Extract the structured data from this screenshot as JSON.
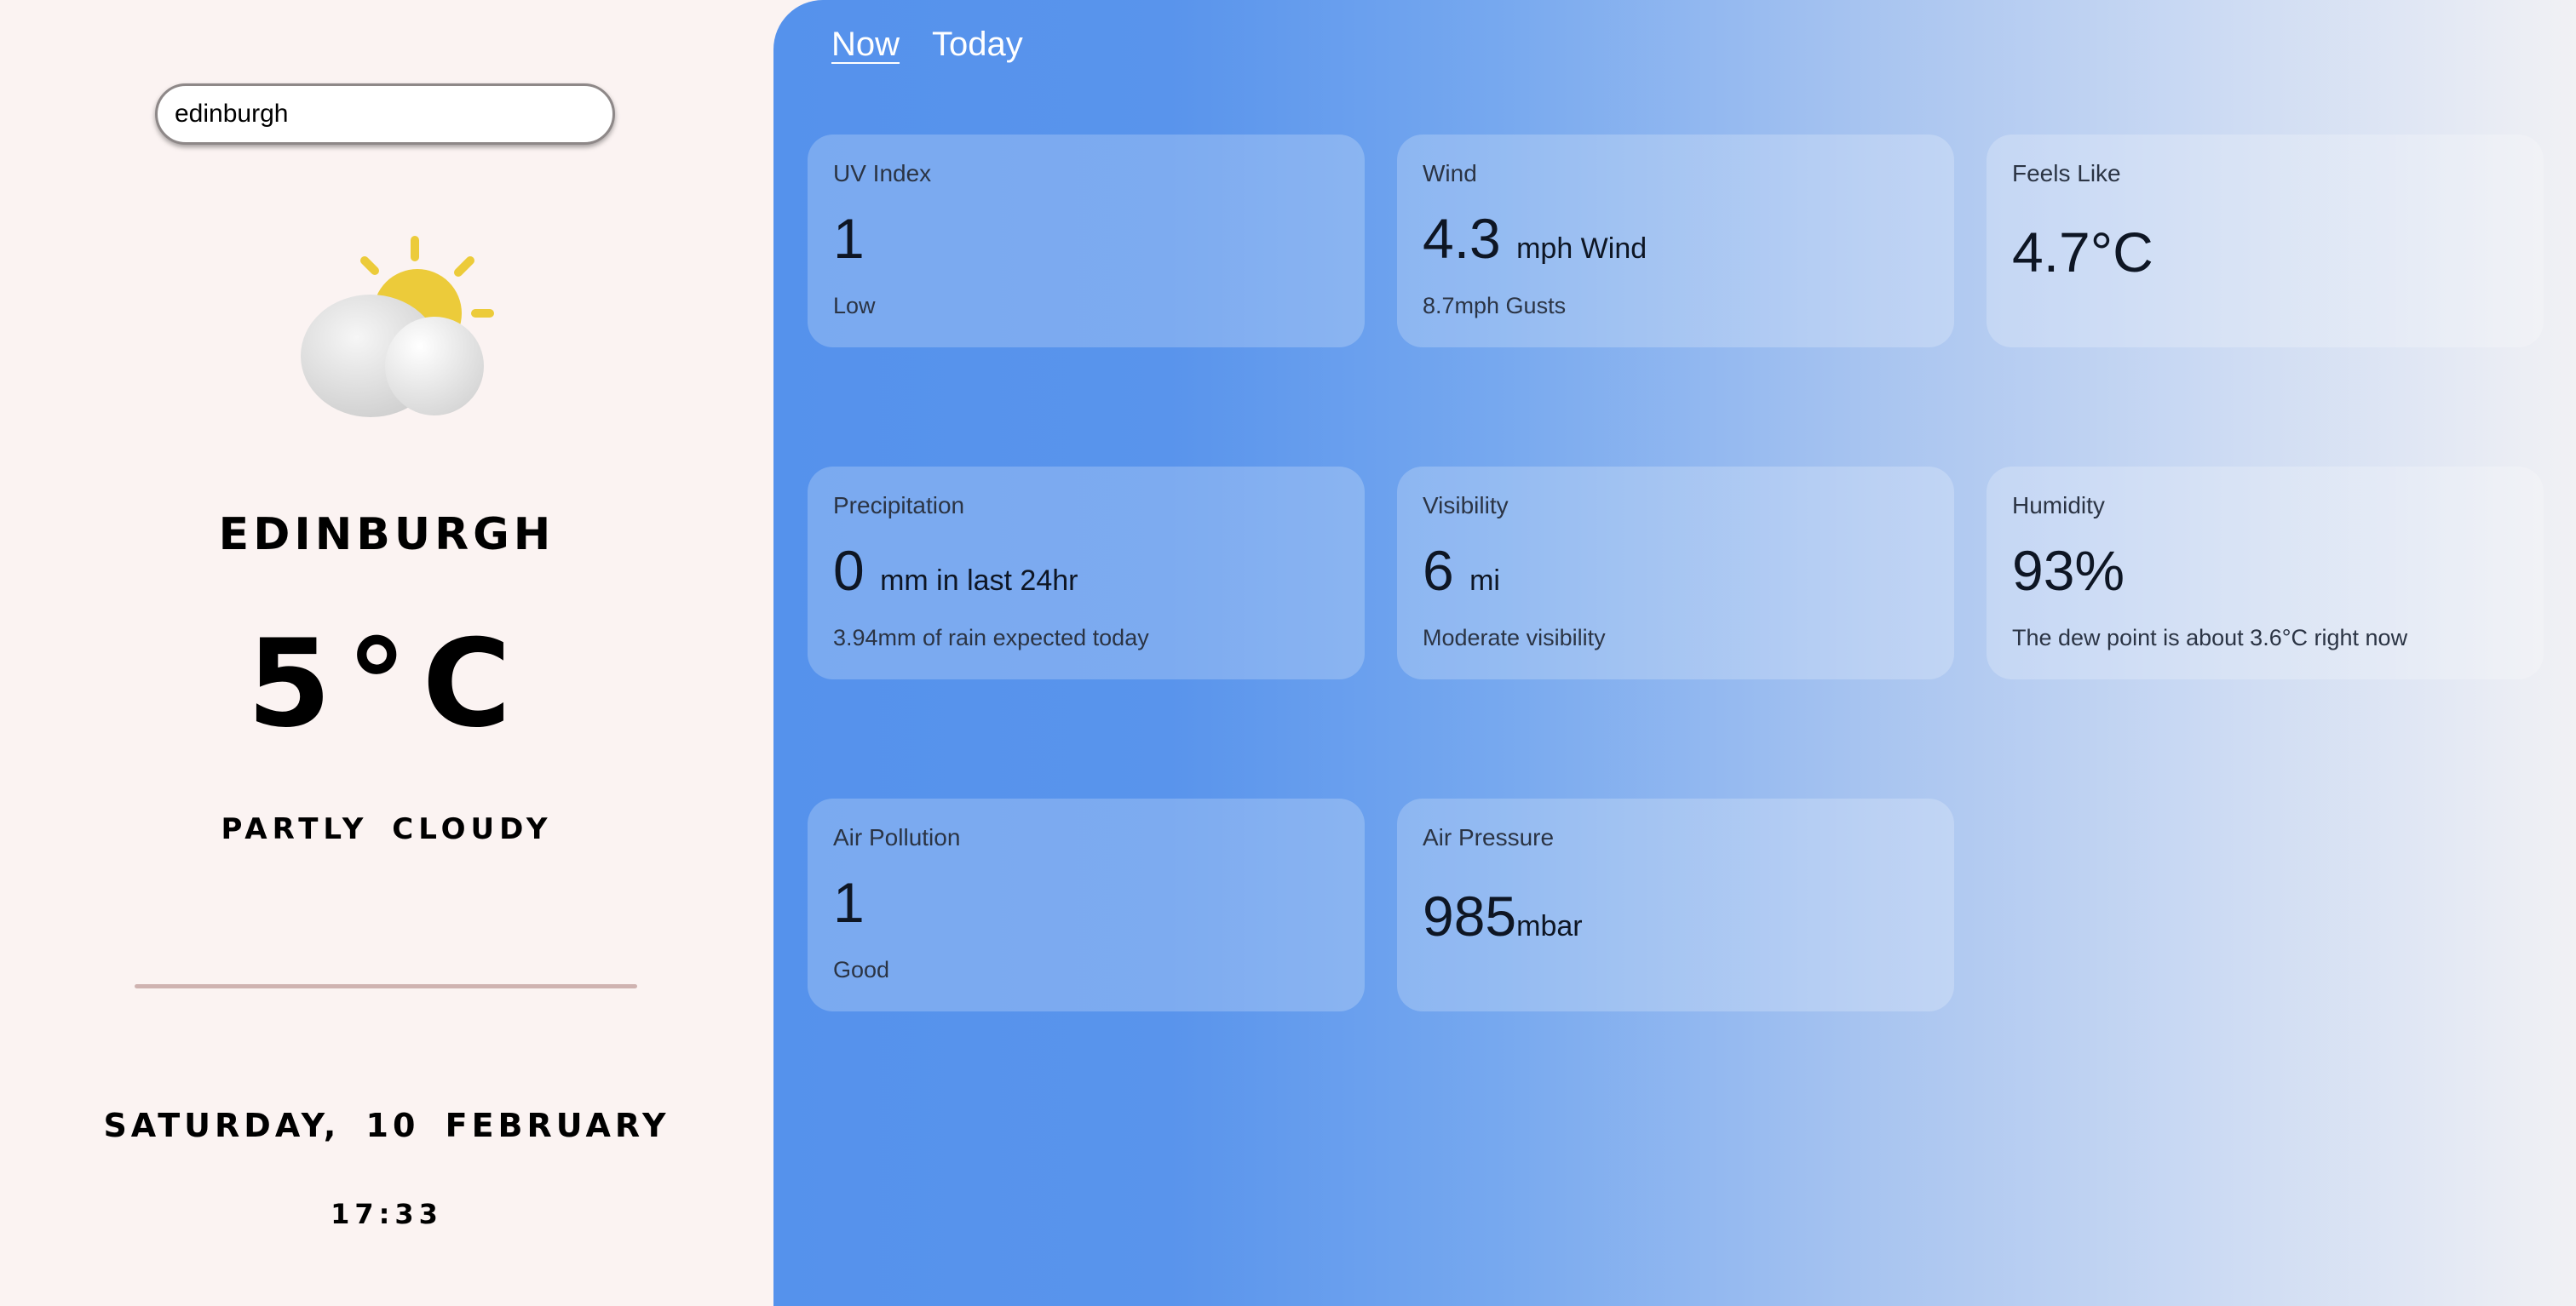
{
  "search": {
    "value": "edinburgh"
  },
  "location": {
    "city": "EDINBURGH"
  },
  "current": {
    "temperature": "5°C",
    "condition": "PARTLY CLOUDY",
    "icon": "partly-cloudy-icon"
  },
  "datetime": {
    "date": "SATURDAY, 10 FEBRUARY",
    "time": "17:33"
  },
  "tabs": [
    {
      "label": "Now",
      "active": true
    },
    {
      "label": "Today",
      "active": false
    }
  ],
  "cards": {
    "uv": {
      "label": "UV Index",
      "value": "1",
      "sub": "Low"
    },
    "wind": {
      "label": "Wind",
      "value": "4.3",
      "unit": "mph Wind",
      "sub": "8.7mph Gusts"
    },
    "feels": {
      "label": "Feels Like",
      "value": "4.7°C"
    },
    "precip": {
      "label": "Precipitation",
      "value": "0",
      "unit": "mm in last 24hr",
      "sub": "3.94mm of rain expected today"
    },
    "visibility": {
      "label": "Visibility",
      "value": "6",
      "unit": "mi",
      "sub": "Moderate visibility"
    },
    "humidity": {
      "label": "Humidity",
      "value": "93%",
      "sub": "The dew point is about 3.6°C right now"
    },
    "pollution": {
      "label": "Air Pollution",
      "value": "1",
      "sub": "Good"
    },
    "pressure": {
      "label": "Air Pressure",
      "value": "985",
      "unit": "mbar"
    }
  },
  "colors": {
    "left_background": "#fbf3f2",
    "accent_blue": "#5592ec",
    "sun": "#eccb3a",
    "divider": "#cfb3b1"
  }
}
